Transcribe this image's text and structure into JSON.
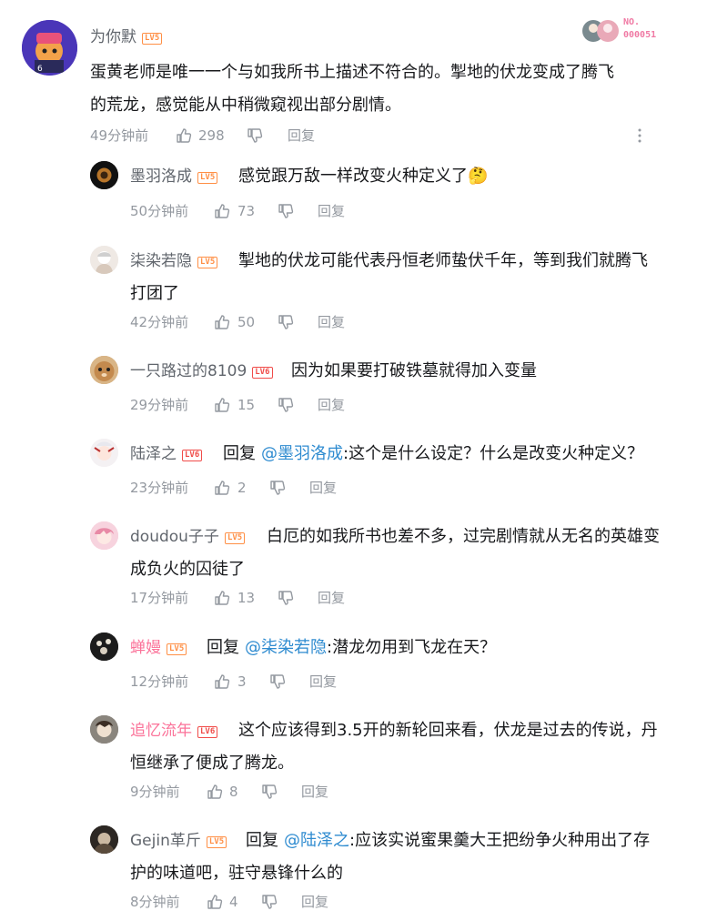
{
  "top": {
    "user": "为你默",
    "level": "LV5",
    "text_line1": "蛋黄老师是唯一一个与如我所书上描述不符合的。掣地的伏龙变成了腾飞",
    "text_line2": "的荒龙，感觉能从中稍微窥视出部分剧情。",
    "time": "49分钟前",
    "likes": "298",
    "reply": "回复",
    "badge_label": "NO.",
    "badge_number": "000051"
  },
  "replies": [
    {
      "user": "墨羽洛成",
      "level": "LV5",
      "prefix": "",
      "at": "",
      "text": "感觉跟万敌一样改变火种定义了🤔",
      "line2": "",
      "time": "50分钟前",
      "likes": "73",
      "reply": "回复"
    },
    {
      "user": "柒染若隐",
      "level": "LV5",
      "prefix": "",
      "at": "",
      "text": "掣地的伏龙可能代表丹恒老师蛰伏千年，等到我们就腾飞",
      "line2": "打团了",
      "time": "42分钟前",
      "likes": "50",
      "reply": "回复"
    },
    {
      "user": "一只路过的8109",
      "level": "LV6",
      "prefix": "",
      "at": "",
      "text": "因为如果要打破铁墓就得加入变量",
      "line2": "",
      "time": "29分钟前",
      "likes": "15",
      "reply": "回复"
    },
    {
      "user": "陆泽之",
      "level": "LV6",
      "prefix": "回复",
      "at": "@墨羽洛成",
      "text": ":这个是什么设定？什么是改变火种定义？",
      "line2": "",
      "time": "23分钟前",
      "likes": "2",
      "reply": "回复"
    },
    {
      "user": "doudou子子",
      "level": "LV5",
      "prefix": "",
      "at": "",
      "text": "白厄的如我所书也差不多，过完剧情就从无名的英雄变",
      "line2": "成负火的囚徒了",
      "time": "17分钟前",
      "likes": "13",
      "reply": "回复"
    },
    {
      "user": "蝉嫚",
      "level": "LV5",
      "prefix": "回复",
      "at": "@柒染若隐",
      "text": ":潜龙勿用到飞龙在天？",
      "line2": "",
      "time": "12分钟前",
      "likes": "3",
      "reply": "回复"
    },
    {
      "user": "追忆流年",
      "level": "LV6",
      "prefix": "",
      "at": "",
      "text": "这个应该得到3.5开的新轮回来看，伏龙是过去的传说，丹",
      "line2": "恒继承了便成了腾龙。",
      "time": "9分钟前",
      "likes": "8",
      "reply": "回复"
    },
    {
      "user": "Gejin革斤",
      "level": "LV5",
      "prefix": "回复",
      "at": "@陆泽之",
      "text": ":应该实说蜜果羹大王把纷争火种用出了存",
      "line2": "护的味道吧，驻守悬锋什么的",
      "time": "8分钟前",
      "likes": "4",
      "reply": "回复"
    }
  ]
}
